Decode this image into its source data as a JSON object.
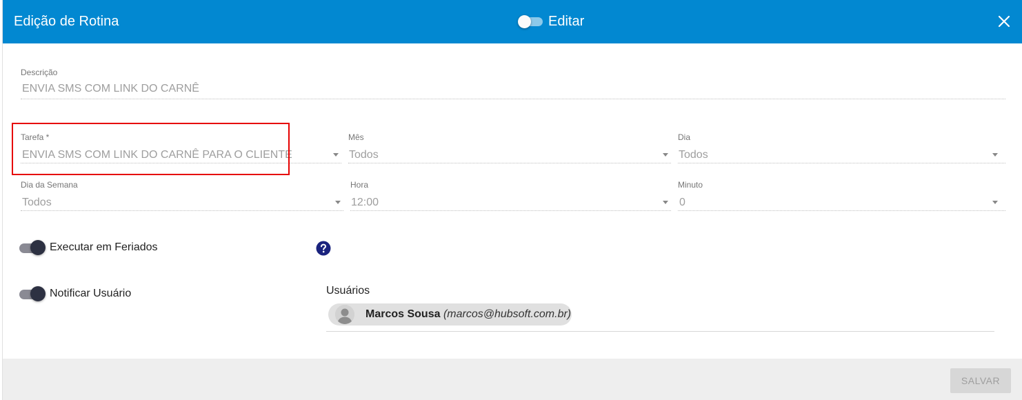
{
  "header": {
    "title": "Edição de Rotina",
    "edit_label": "Editar",
    "edit_toggle_on": false,
    "close_icon": "close-icon"
  },
  "form": {
    "descricao": {
      "label": "Descrição",
      "value": "ENVIA SMS COM LINK DO CARNÊ"
    },
    "tarefa": {
      "label": "Tarefa *",
      "value": "ENVIA SMS COM LINK DO CARNÊ PARA O CLIENTE"
    },
    "mes": {
      "label": "Mês",
      "value": "Todos"
    },
    "dia": {
      "label": "Dia",
      "value": "Todos"
    },
    "dia_semana": {
      "label": "Dia da Semana",
      "value": "Todos"
    },
    "hora": {
      "label": "Hora",
      "value": "12:00"
    },
    "minuto": {
      "label": "Minuto",
      "value": "0"
    },
    "executar_feriados": {
      "label": "Executar em Feriados",
      "on": true,
      "help_icon": "question-circle-icon"
    },
    "notificar_usuario": {
      "label": "Notificar Usuário",
      "on": true
    }
  },
  "users": {
    "label": "Usuários",
    "chips": [
      {
        "name": "Marcos Sousa",
        "email": "(marcos@hubsoft.com.br)",
        "avatar_icon": "person-avatar-icon"
      }
    ]
  },
  "footer": {
    "save_label": "SALVAR"
  },
  "colors": {
    "header": "#0288d1",
    "highlight": "#e60000",
    "help_icon": "#1a237e"
  }
}
